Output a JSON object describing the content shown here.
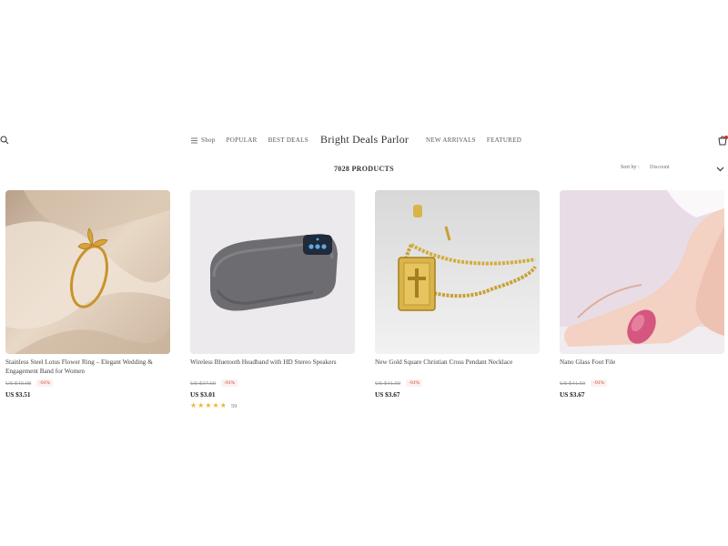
{
  "header": {
    "nav_left": [
      {
        "label": "Shop",
        "icon": "menu-icon"
      },
      {
        "label": "POPULAR"
      },
      {
        "label": "BEST DEALS"
      }
    ],
    "logo": "Bright Deals Parlor",
    "nav_right": [
      {
        "label": "NEW ARRIVALS"
      },
      {
        "label": "FEATURED"
      }
    ]
  },
  "toolbar": {
    "product_count": "7028 PRODUCTS",
    "sort_label": "Sort by :",
    "sort_value": "Discount"
  },
  "products": [
    {
      "title": "Stainless Steel Lotus Flower Ring – Elegant Wedding & Engagement Band for Women",
      "old_price": "US $40.98",
      "discount": "-91%",
      "price": "US $3.51"
    },
    {
      "title": "Wireless Bluetooth Headband with HD Stereo Speakers",
      "old_price": "US $37.60",
      "discount": "-91%",
      "price": "US $3.01",
      "rating_count": "59"
    },
    {
      "title": "New Gold Square Christian Cross Pendant Necklace",
      "old_price": "US $41.50",
      "discount": "-91%",
      "price": "US $3.67"
    },
    {
      "title": "Nano Glass Foot File",
      "old_price": "US $41.50",
      "discount": "-91%",
      "price": "US $3.67"
    }
  ],
  "colors": {
    "accent_red": "#c0392b",
    "star": "#f0b43c"
  }
}
